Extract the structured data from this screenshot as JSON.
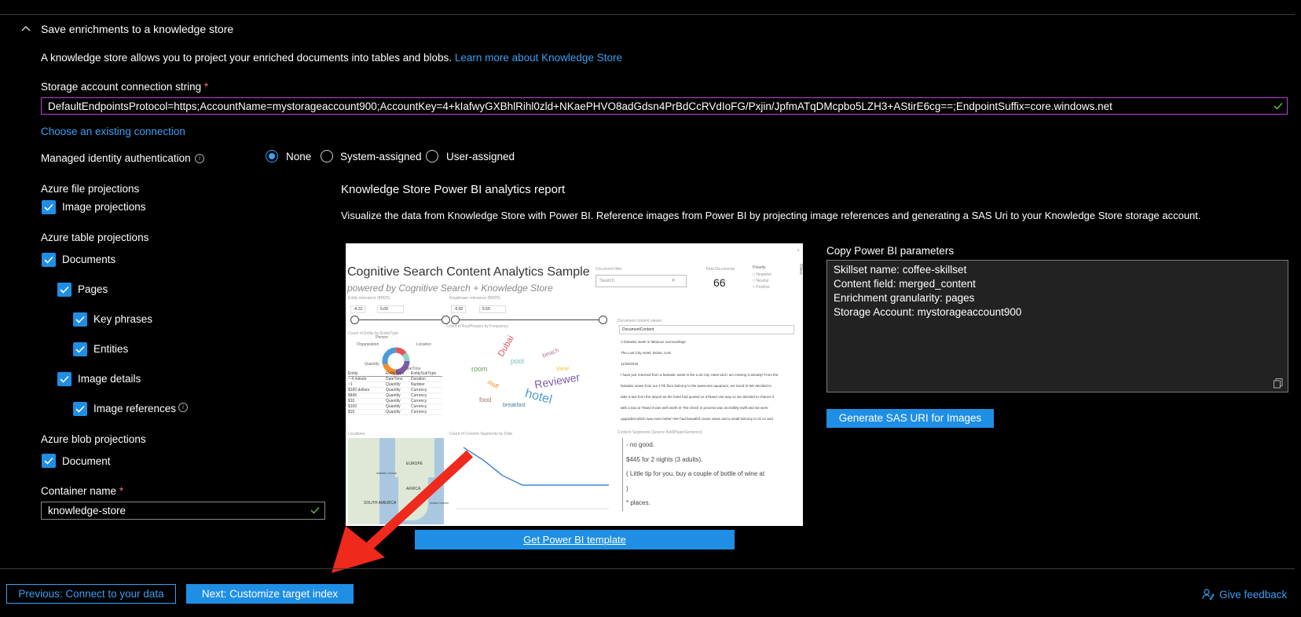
{
  "section": {
    "title": "Save enrichments to a knowledge store",
    "description": "A knowledge store allows you to project your enriched documents into tables and blobs.",
    "learn_more": "Learn more about Knowledge Store"
  },
  "storage": {
    "label": "Storage account connection string",
    "value": "DefaultEndpointsProtocol=https;AccountName=mystorageaccount900;AccountKey=4+kIafwyGXBhlRihl0zld+NKaePHVO8adGdsn4PrBdCcRVdIoFG/Pxjin/JpfmATqDMcpbo5LZH3+AStirE6cg==;EndpointSuffix=core.windows.net",
    "choose_existing": "Choose an existing connection"
  },
  "identity": {
    "label": "Managed identity authentication",
    "options": [
      "None",
      "System-assigned",
      "User-assigned"
    ],
    "selected": "None"
  },
  "projections": {
    "file_heading": "Azure file projections",
    "image_projections": "Image projections",
    "table_heading": "Azure table projections",
    "documents": "Documents",
    "pages": "Pages",
    "key_phrases": "Key phrases",
    "entities": "Entities",
    "image_details": "Image details",
    "image_references": "Image references",
    "blob_heading": "Azure blob projections",
    "document": "Document"
  },
  "container": {
    "label": "Container name",
    "value": "knowledge-store"
  },
  "powerbi": {
    "title": "Knowledge Store Power BI analytics report",
    "description": "Visualize the data from Knowledge Store with Power BI. Reference images from Power BI by projecting image references and generating a SAS Uri to your Knowledge Store storage account.",
    "get_template": "Get Power BI template",
    "params_label": "Copy Power BI parameters",
    "params_lines": [
      "Skillset name: coffee-skillset",
      "Content field: merged_content",
      "Enrichment granularity: pages",
      "Storage Account: mystorageaccount900"
    ],
    "generate_sas": "Generate SAS URI for Images"
  },
  "report_preview": {
    "title": "Cognitive Search Content Analytics Sample",
    "subtitle": "powered by Cognitive Search + Knowledge Store",
    "search_placeholder": "Search",
    "total_documents": "66",
    "total_documents_label": "Total Documents",
    "document_filter_label": "Document filter",
    "polarity_label": "Polarity",
    "polarity_options": [
      "Negative",
      "Neutral",
      "Positive"
    ],
    "entity_relevance_label": "Entity relevance (BM25)",
    "entity_range": [
      "-4.31",
      "5.09"
    ],
    "keyphrase_relevance_label": "Keyphrase relevance (BM25)",
    "keyphrase_range": [
      "-6.82",
      "5.55"
    ],
    "entity_count_label": "Count of Entity by EntityType",
    "keyphrase_count_label": "Count of KeyPhrases by Frequency",
    "viewer_label": "Document content viewer",
    "viewer_header": "DocumentContent",
    "viewer_lines": [
      "A fantastic week in fabulous surroundings",
      "The Lost City Hotel, Dubai, UAE",
      "11/25/2018",
      "I have just returned from a fantastic week in the Lost City Hotel and I am missing it already! From the",
      "fantastic views from our 17th floor balcony to the awesome aquarium, we loved it! We decided to",
      "take a taxi from the airport as the hotel had quoted us 375aed one way so we decided to chance it",
      "with a taxi at 70aed it was well worth it! The check in process was incredibly swift and we were",
      "upgraded which was even better! We had beautiful ocean views and a small balcony to sit on and"
    ],
    "donut_labels": [
      "Person",
      "Location",
      "Organization",
      "Quantity",
      "DateTime"
    ],
    "entity_table_headers": [
      "Entity",
      "EntityType",
      "EntitySubType"
    ],
    "entity_table_rows": [
      [
        "~ 4 minute",
        "DateTime",
        "Duration"
      ],
      [
        "~1",
        "Quantity",
        "Number"
      ],
      [
        "$160 dollars",
        "Quantity",
        "Currency"
      ],
      [
        "$445",
        "Quantity",
        "Currency"
      ],
      [
        "$10",
        "Quantity",
        "Currency"
      ],
      [
        "$100",
        "Quantity",
        "Currency"
      ],
      [
        "$15",
        "Quantity",
        "Currency"
      ]
    ],
    "locations_label": "Locations",
    "map_labels": [
      "EUROPE",
      "AFRICA",
      "SOUTH AMERICA",
      "Atlantic Ocean",
      "Indian Ocean"
    ],
    "segments_label": "Count of Content Segments by Date",
    "content_segments_label": "Content Segments (Source field/Page/Sentence)",
    "segments": [
      "- no good.",
      "$445 for 2 nights (3 adults).",
      "( Little tip for you, buy a couple of bottle of wine at",
      ")",
      "* places."
    ],
    "word_cloud": [
      "Reviewer",
      "hotel",
      "Dubai",
      "room",
      "staff",
      "pool",
      "beach",
      "food",
      "breakfast",
      "view"
    ]
  },
  "footer": {
    "previous": "Previous: Connect to your data",
    "next": "Next: Customize target index",
    "feedback": "Give feedback"
  },
  "colors": {
    "accent": "#1f8fe5",
    "link": "#3aa0f3",
    "required": "#f1707b",
    "valid_check": "#5fb83c",
    "annotation_arrow": "#f0291d"
  }
}
